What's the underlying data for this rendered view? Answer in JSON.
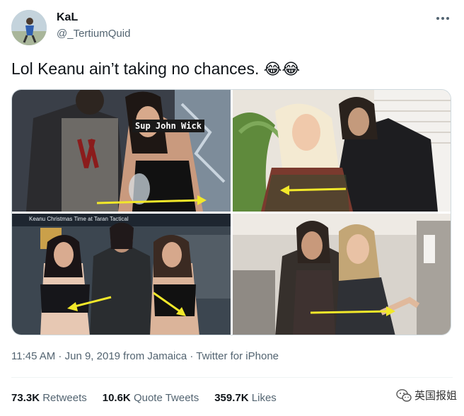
{
  "author": {
    "name": "KaL",
    "handle": "@_TertiumQuid"
  },
  "tweet": {
    "text": "Lol Keanu ain’t taking no chances.",
    "emojis": "😂😂"
  },
  "media": {
    "photo1_caption": "Sup John Wick",
    "photo3_overlay_title": "Keanu Christmas Time at Taran Tactical"
  },
  "meta": {
    "time": "11:45 AM",
    "separator1": " · ",
    "date": "Jun 9, 2019",
    "location": " from Jamaica",
    "separator2": " · ",
    "source": "Twitter for iPhone"
  },
  "stats": {
    "retweets_count": "73.3K",
    "retweets_label": "Retweets",
    "quotes_count": "10.6K",
    "quotes_label": "Quote Tweets",
    "likes_count": "359.7K",
    "likes_label": "Likes"
  },
  "watermark": {
    "text": "英国报姐"
  },
  "icons": {
    "more": "more-horizontal-icon",
    "watermark": "wechat-icon"
  },
  "colors": {
    "text_primary": "#0f1419",
    "text_secondary": "#536471",
    "arrow_yellow": "#f2e82a",
    "border": "#cfd9de"
  }
}
